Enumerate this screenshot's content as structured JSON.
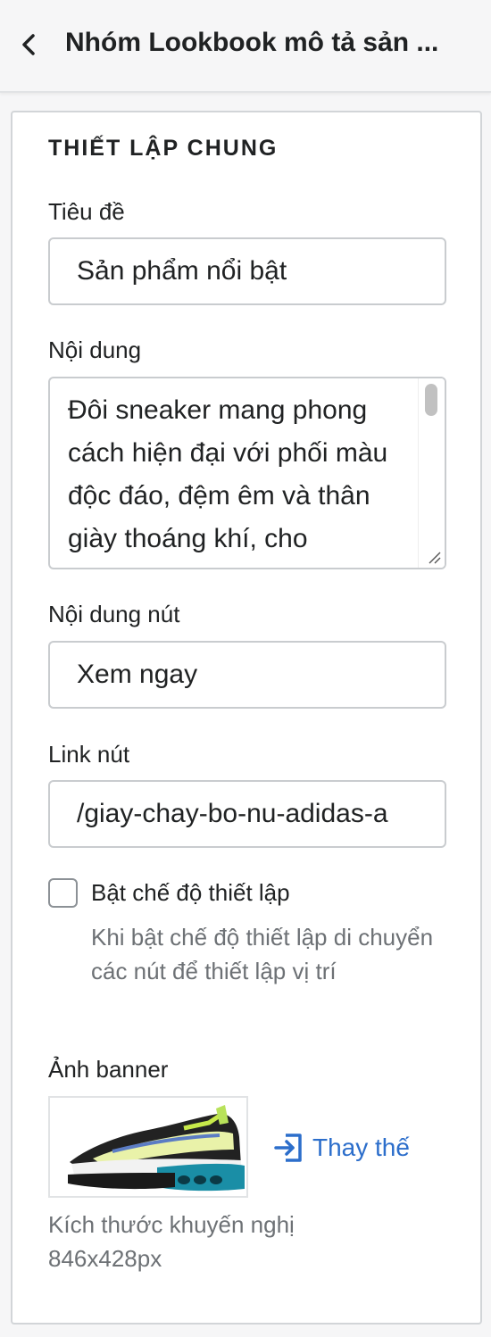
{
  "header": {
    "title": "Nhóm Lookbook mô tả sản ...",
    "back_icon": "chevron-left-icon"
  },
  "section": {
    "title": "THIẾT LẬP CHUNG"
  },
  "fields": {
    "title_label": "Tiêu đề",
    "title_value": "Sản phẩm nổi bật",
    "content_label": "Nội dung",
    "content_value": "Đôi sneaker mang phong cách hiện đại với phối màu độc đáo, đệm êm và thân giày thoáng khí, cho",
    "button_text_label": "Nội dung nút",
    "button_text_value": "Xem ngay",
    "button_link_label": "Link nút",
    "button_link_value": "/giay-chay-bo-nu-adidas-a"
  },
  "setup_toggle": {
    "label": "Bật chế độ thiết lập",
    "checked": false,
    "help": "Khi bật chế độ thiết lập di chuyển các nút để thiết lập vị trí"
  },
  "banner": {
    "label": "Ảnh banner",
    "image_alt": "sneaker-image",
    "replace_label": "Thay thế",
    "replace_icon": "import-icon",
    "size_note": "Kích thước khuyến nghị 846x428px"
  },
  "colors": {
    "accent": "#2c6ecb",
    "text": "#202223",
    "subdued": "#6d7175",
    "border": "#c9cccf"
  }
}
